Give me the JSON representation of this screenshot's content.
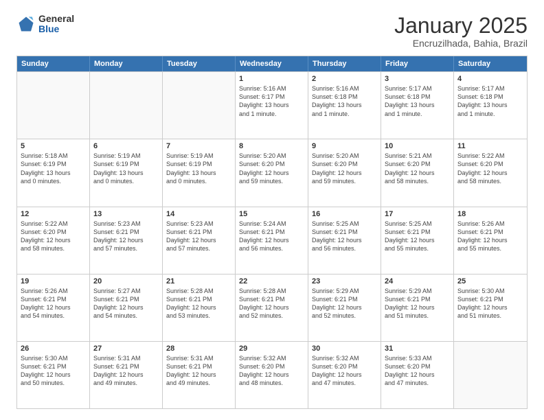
{
  "logo": {
    "general": "General",
    "blue": "Blue"
  },
  "title": "January 2025",
  "subtitle": "Encruzilhada, Bahia, Brazil",
  "header_days": [
    "Sunday",
    "Monday",
    "Tuesday",
    "Wednesday",
    "Thursday",
    "Friday",
    "Saturday"
  ],
  "weeks": [
    [
      {
        "day": "",
        "lines": []
      },
      {
        "day": "",
        "lines": []
      },
      {
        "day": "",
        "lines": []
      },
      {
        "day": "1",
        "lines": [
          "Sunrise: 5:16 AM",
          "Sunset: 6:17 PM",
          "Daylight: 13 hours",
          "and 1 minute."
        ]
      },
      {
        "day": "2",
        "lines": [
          "Sunrise: 5:16 AM",
          "Sunset: 6:18 PM",
          "Daylight: 13 hours",
          "and 1 minute."
        ]
      },
      {
        "day": "3",
        "lines": [
          "Sunrise: 5:17 AM",
          "Sunset: 6:18 PM",
          "Daylight: 13 hours",
          "and 1 minute."
        ]
      },
      {
        "day": "4",
        "lines": [
          "Sunrise: 5:17 AM",
          "Sunset: 6:18 PM",
          "Daylight: 13 hours",
          "and 1 minute."
        ]
      }
    ],
    [
      {
        "day": "5",
        "lines": [
          "Sunrise: 5:18 AM",
          "Sunset: 6:19 PM",
          "Daylight: 13 hours",
          "and 0 minutes."
        ]
      },
      {
        "day": "6",
        "lines": [
          "Sunrise: 5:19 AM",
          "Sunset: 6:19 PM",
          "Daylight: 13 hours",
          "and 0 minutes."
        ]
      },
      {
        "day": "7",
        "lines": [
          "Sunrise: 5:19 AM",
          "Sunset: 6:19 PM",
          "Daylight: 13 hours",
          "and 0 minutes."
        ]
      },
      {
        "day": "8",
        "lines": [
          "Sunrise: 5:20 AM",
          "Sunset: 6:20 PM",
          "Daylight: 12 hours",
          "and 59 minutes."
        ]
      },
      {
        "day": "9",
        "lines": [
          "Sunrise: 5:20 AM",
          "Sunset: 6:20 PM",
          "Daylight: 12 hours",
          "and 59 minutes."
        ]
      },
      {
        "day": "10",
        "lines": [
          "Sunrise: 5:21 AM",
          "Sunset: 6:20 PM",
          "Daylight: 12 hours",
          "and 58 minutes."
        ]
      },
      {
        "day": "11",
        "lines": [
          "Sunrise: 5:22 AM",
          "Sunset: 6:20 PM",
          "Daylight: 12 hours",
          "and 58 minutes."
        ]
      }
    ],
    [
      {
        "day": "12",
        "lines": [
          "Sunrise: 5:22 AM",
          "Sunset: 6:20 PM",
          "Daylight: 12 hours",
          "and 58 minutes."
        ]
      },
      {
        "day": "13",
        "lines": [
          "Sunrise: 5:23 AM",
          "Sunset: 6:21 PM",
          "Daylight: 12 hours",
          "and 57 minutes."
        ]
      },
      {
        "day": "14",
        "lines": [
          "Sunrise: 5:23 AM",
          "Sunset: 6:21 PM",
          "Daylight: 12 hours",
          "and 57 minutes."
        ]
      },
      {
        "day": "15",
        "lines": [
          "Sunrise: 5:24 AM",
          "Sunset: 6:21 PM",
          "Daylight: 12 hours",
          "and 56 minutes."
        ]
      },
      {
        "day": "16",
        "lines": [
          "Sunrise: 5:25 AM",
          "Sunset: 6:21 PM",
          "Daylight: 12 hours",
          "and 56 minutes."
        ]
      },
      {
        "day": "17",
        "lines": [
          "Sunrise: 5:25 AM",
          "Sunset: 6:21 PM",
          "Daylight: 12 hours",
          "and 55 minutes."
        ]
      },
      {
        "day": "18",
        "lines": [
          "Sunrise: 5:26 AM",
          "Sunset: 6:21 PM",
          "Daylight: 12 hours",
          "and 55 minutes."
        ]
      }
    ],
    [
      {
        "day": "19",
        "lines": [
          "Sunrise: 5:26 AM",
          "Sunset: 6:21 PM",
          "Daylight: 12 hours",
          "and 54 minutes."
        ]
      },
      {
        "day": "20",
        "lines": [
          "Sunrise: 5:27 AM",
          "Sunset: 6:21 PM",
          "Daylight: 12 hours",
          "and 54 minutes."
        ]
      },
      {
        "day": "21",
        "lines": [
          "Sunrise: 5:28 AM",
          "Sunset: 6:21 PM",
          "Daylight: 12 hours",
          "and 53 minutes."
        ]
      },
      {
        "day": "22",
        "lines": [
          "Sunrise: 5:28 AM",
          "Sunset: 6:21 PM",
          "Daylight: 12 hours",
          "and 52 minutes."
        ]
      },
      {
        "day": "23",
        "lines": [
          "Sunrise: 5:29 AM",
          "Sunset: 6:21 PM",
          "Daylight: 12 hours",
          "and 52 minutes."
        ]
      },
      {
        "day": "24",
        "lines": [
          "Sunrise: 5:29 AM",
          "Sunset: 6:21 PM",
          "Daylight: 12 hours",
          "and 51 minutes."
        ]
      },
      {
        "day": "25",
        "lines": [
          "Sunrise: 5:30 AM",
          "Sunset: 6:21 PM",
          "Daylight: 12 hours",
          "and 51 minutes."
        ]
      }
    ],
    [
      {
        "day": "26",
        "lines": [
          "Sunrise: 5:30 AM",
          "Sunset: 6:21 PM",
          "Daylight: 12 hours",
          "and 50 minutes."
        ]
      },
      {
        "day": "27",
        "lines": [
          "Sunrise: 5:31 AM",
          "Sunset: 6:21 PM",
          "Daylight: 12 hours",
          "and 49 minutes."
        ]
      },
      {
        "day": "28",
        "lines": [
          "Sunrise: 5:31 AM",
          "Sunset: 6:21 PM",
          "Daylight: 12 hours",
          "and 49 minutes."
        ]
      },
      {
        "day": "29",
        "lines": [
          "Sunrise: 5:32 AM",
          "Sunset: 6:20 PM",
          "Daylight: 12 hours",
          "and 48 minutes."
        ]
      },
      {
        "day": "30",
        "lines": [
          "Sunrise: 5:32 AM",
          "Sunset: 6:20 PM",
          "Daylight: 12 hours",
          "and 47 minutes."
        ]
      },
      {
        "day": "31",
        "lines": [
          "Sunrise: 5:33 AM",
          "Sunset: 6:20 PM",
          "Daylight: 12 hours",
          "and 47 minutes."
        ]
      },
      {
        "day": "",
        "lines": []
      }
    ]
  ]
}
